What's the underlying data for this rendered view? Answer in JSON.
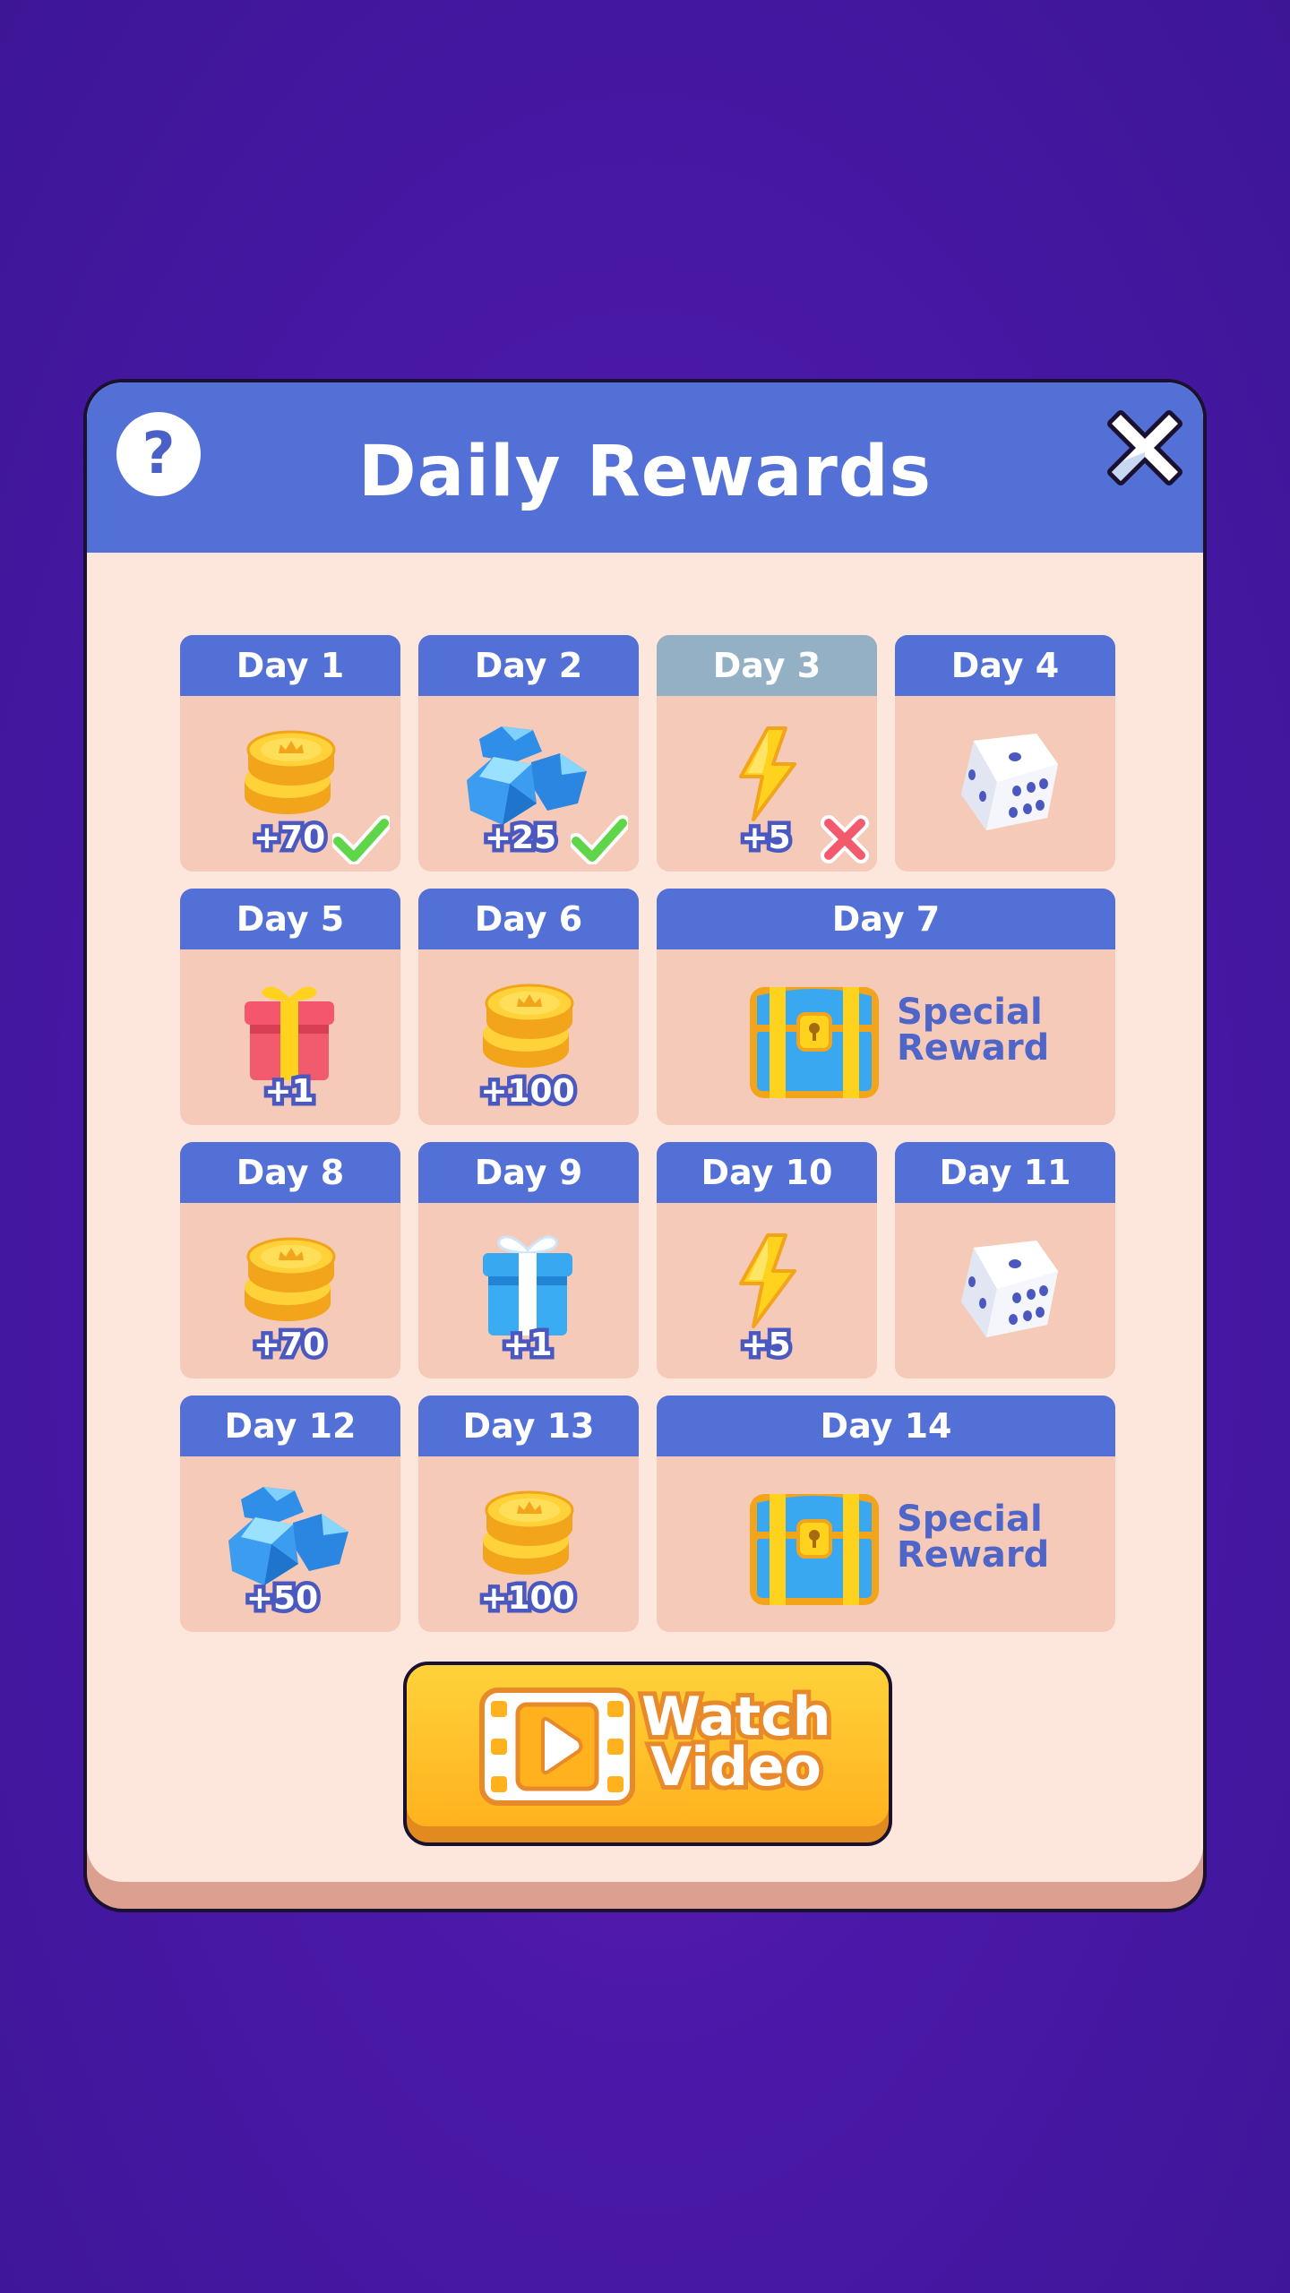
{
  "title": "Daily Rewards",
  "help_label": "?",
  "days": [
    {
      "label": "Day 1",
      "amount": "+70",
      "status": "claimed",
      "reward": "coins"
    },
    {
      "label": "Day 2",
      "amount": "+25",
      "status": "claimed",
      "reward": "gems"
    },
    {
      "label": "Day 3",
      "amount": "+5",
      "status": "missed",
      "reward": "energy"
    },
    {
      "label": "Day 4",
      "amount": "",
      "status": "upcoming",
      "reward": "dice"
    },
    {
      "label": "Day 5",
      "amount": "+1",
      "status": "upcoming",
      "reward": "gift-red"
    },
    {
      "label": "Day 6",
      "amount": "+100",
      "status": "upcoming",
      "reward": "coins"
    },
    {
      "label": "Day 7",
      "amount": "",
      "status": "upcoming",
      "reward": "chest",
      "special_line1": "Special",
      "special_line2": "Reward"
    },
    {
      "label": "Day 8",
      "amount": "+70",
      "status": "upcoming",
      "reward": "coins"
    },
    {
      "label": "Day 9",
      "amount": "+1",
      "status": "upcoming",
      "reward": "gift-blue"
    },
    {
      "label": "Day 10",
      "amount": "+5",
      "status": "upcoming",
      "reward": "energy"
    },
    {
      "label": "Day 11",
      "amount": "",
      "status": "upcoming",
      "reward": "dice"
    },
    {
      "label": "Day 12",
      "amount": "+50",
      "status": "upcoming",
      "reward": "gems"
    },
    {
      "label": "Day 13",
      "amount": "+100",
      "status": "upcoming",
      "reward": "coins"
    },
    {
      "label": "Day 14",
      "amount": "",
      "status": "upcoming",
      "reward": "chest",
      "special_line1": "Special",
      "special_line2": "Reward"
    }
  ],
  "watch_button": {
    "line1": "Watch",
    "line2": "Video",
    "icon": "film-play-icon"
  },
  "colors": {
    "header": "#5270d6",
    "panel": "#fde6dc",
    "card": "#f5cab8",
    "missed_header": "#94b0c4",
    "accent_text": "#4f66c8",
    "button": "#ffc52a"
  }
}
